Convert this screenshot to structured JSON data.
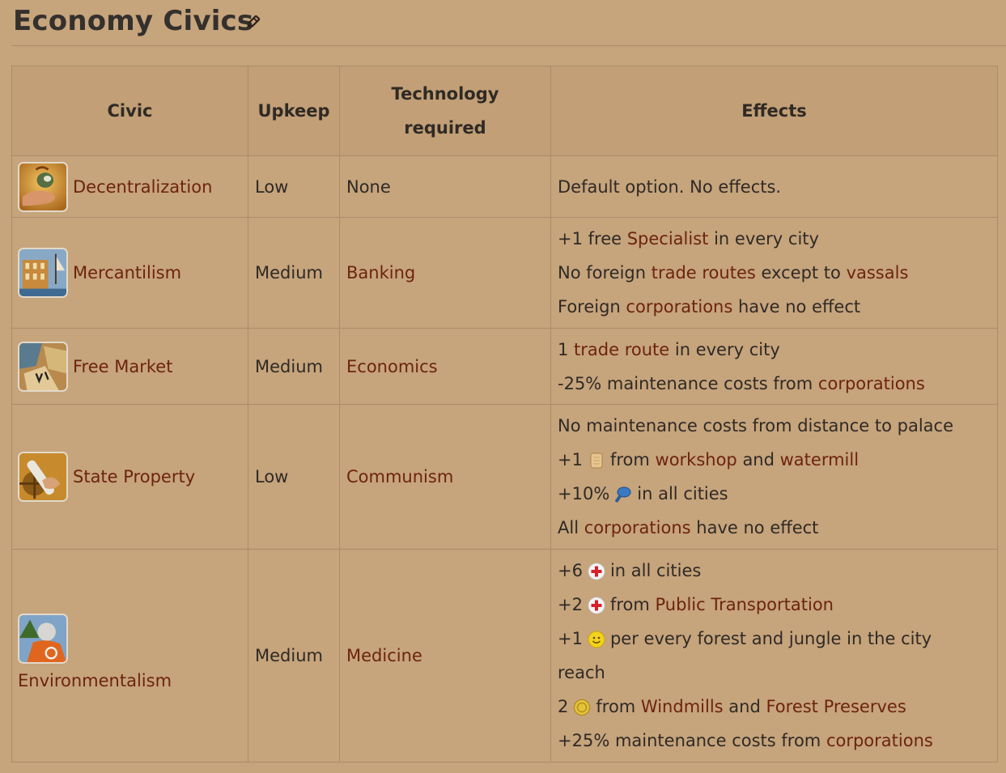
{
  "page": {
    "title": "Economy Civics",
    "edit_icon": "pencil-icon"
  },
  "colors": {
    "background": "#c6a47c",
    "header_background": "#c29f76",
    "border": "#ab8c67",
    "link": "#6d240e",
    "text": "#2f2a25"
  },
  "table": {
    "headers": {
      "civic": "Civic",
      "upkeep": "Upkeep",
      "tech_line1": "Technology",
      "tech_line2": "required",
      "effects": "Effects"
    },
    "rows": [
      {
        "civic": "Decentralization",
        "icon": "decentralization-icon",
        "upkeep": "Low",
        "tech": "None",
        "effects": [
          {
            "text": "Default option. No effects."
          }
        ]
      },
      {
        "civic": "Mercantilism",
        "icon": "mercantilism-icon",
        "upkeep": "Medium",
        "tech": "Banking",
        "effects": [
          {
            "pre": "+1 free ",
            "link": "Specialist",
            "post": " in every city"
          },
          {
            "pre": "No foreign ",
            "link1": "trade routes",
            "mid": " except to ",
            "link2": "vassals"
          },
          {
            "pre": "Foreign ",
            "link": "corporations",
            "post": " have no effect"
          }
        ]
      },
      {
        "civic": "Free Market",
        "icon": "free-market-icon",
        "upkeep": "Medium",
        "tech": "Economics",
        "effects": [
          {
            "pre": "1 ",
            "link": "trade route",
            "post": " in every city"
          },
          {
            "pre": "-25% maintenance costs from ",
            "link": "corporations"
          }
        ]
      },
      {
        "civic": "State Property",
        "icon": "state-property-icon",
        "upkeep": "Low",
        "tech": "Communism",
        "effects": [
          {
            "text": "No maintenance costs from distance to palace"
          },
          {
            "pre": "+1",
            "icon": "food-icon",
            "mid": "from ",
            "link1": "workshop",
            "and": " and ",
            "link2": "watermill"
          },
          {
            "pre": "+10%",
            "icon": "production-icon",
            "post": "in all cities"
          },
          {
            "pre": "All ",
            "link": "corporations",
            "post": " have no effect"
          }
        ]
      },
      {
        "civic": "Environmentalism",
        "icon": "environmentalism-icon",
        "upkeep": "Medium",
        "tech": "Medicine",
        "effects": [
          {
            "pre": "+6",
            "icon": "health-icon",
            "post": "in all cities"
          },
          {
            "pre": "+2",
            "icon": "health-icon",
            "mid": "from ",
            "link": "Public Transportation"
          },
          {
            "pre": "+1",
            "icon": "happiness-icon",
            "post": "per every forest and jungle in the city"
          },
          {
            "text": "reach"
          },
          {
            "pre": "2",
            "icon": "commerce-icon",
            "mid": "from ",
            "link1": "Windmills",
            "and": " and ",
            "link2": "Forest Preserves"
          },
          {
            "pre": "+25% maintenance costs from ",
            "link": "corporations"
          }
        ]
      }
    ]
  }
}
